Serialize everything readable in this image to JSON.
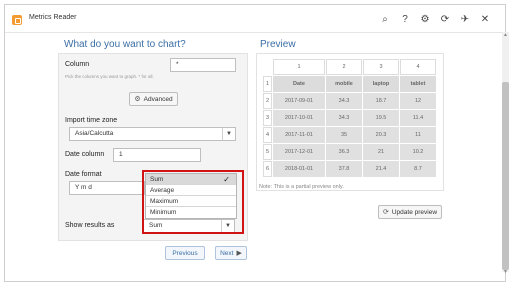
{
  "titlebar": {
    "app_title": "Metrics Reader",
    "icons": [
      "search-icon",
      "help-icon",
      "gear-icon",
      "refresh-icon",
      "pin-icon",
      "close-icon"
    ],
    "icon_glyphs": {
      "search": "⌕",
      "help": "?",
      "gear": "⚙",
      "refresh": "⟳",
      "pin": "✈",
      "close": "✕"
    }
  },
  "left": {
    "section_title": "What do you want to chart?",
    "column_label": "Column",
    "column_value": "*",
    "column_hint": "Pick the columns you want to graph. * for all.",
    "advanced_label": "Advanced",
    "timezone_label": "Import time zone",
    "timezone_value": "Asia/Calcutta",
    "date_column_label": "Date column",
    "date_column_value": "1",
    "date_format_label": "Date format",
    "date_format_value": "Y m d",
    "show_results_label": "Show results as",
    "show_results_value": "Sum",
    "dropdown_options": [
      "Sum",
      "Average",
      "Maximum",
      "Minimum"
    ],
    "dropdown_selected": "Sum"
  },
  "preview": {
    "section_title": "Preview",
    "column_numbers": [
      "1",
      "2",
      "3",
      "4"
    ],
    "headers": [
      "Date",
      "mobile",
      "laptop",
      "tablet"
    ],
    "row_numbers": [
      "1",
      "2",
      "3",
      "4",
      "5",
      "6"
    ],
    "rows": [
      [
        "2017-09-01",
        "34.3",
        "18.7",
        "12"
      ],
      [
        "2017-10-01",
        "34.3",
        "19.5",
        "11.4"
      ],
      [
        "2017-11-01",
        "35",
        "20.3",
        "11"
      ],
      [
        "2017-12-01",
        "36.3",
        "21",
        "10.2"
      ],
      [
        "2018-01-01",
        "37.8",
        "21.4",
        "8.7"
      ]
    ],
    "note": "Note: This is a partial preview only.",
    "update_label": "Update preview"
  },
  "nav": {
    "previous_label": "Previous",
    "next_label": "Next"
  },
  "colors": {
    "accent": "#3a6ea5",
    "highlight_border": "#d01414",
    "app_icon": "#f39c34"
  }
}
